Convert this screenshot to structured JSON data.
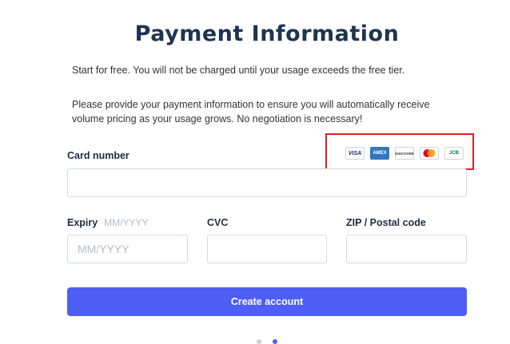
{
  "page": {
    "title": "Payment Information",
    "intro": "Start for free. You will not be charged until your usage exceeds the free tier.",
    "description": "Please provide your payment information to ensure you will automatically receive volume pricing as your usage grows. No negotiation is necessary!"
  },
  "form": {
    "card_number_label": "Card number",
    "card_number_value": "",
    "expiry_label": "Expiry",
    "expiry_hint": "MM/YYYY",
    "expiry_placeholder": "MM/YYYY",
    "cvc_label": "CVC",
    "zip_label": "ZIP / Postal code",
    "submit_label": "Create account"
  },
  "card_brands": [
    {
      "name": "visa-icon",
      "text": "VISA",
      "color": "#1a1f71"
    },
    {
      "name": "amex-icon",
      "text": "AMEX",
      "color": "#2e77bc"
    },
    {
      "name": "discover-icon",
      "text": "DISCOVER",
      "color": "#f58220"
    },
    {
      "name": "mastercard-icon",
      "text": "",
      "color": "#eb001b"
    },
    {
      "name": "jcb-icon",
      "text": "JCB",
      "color": "#0b7a3e"
    }
  ],
  "colors": {
    "accent": "#4e5ef5",
    "title": "#1e3450",
    "highlight": "#e02020"
  }
}
